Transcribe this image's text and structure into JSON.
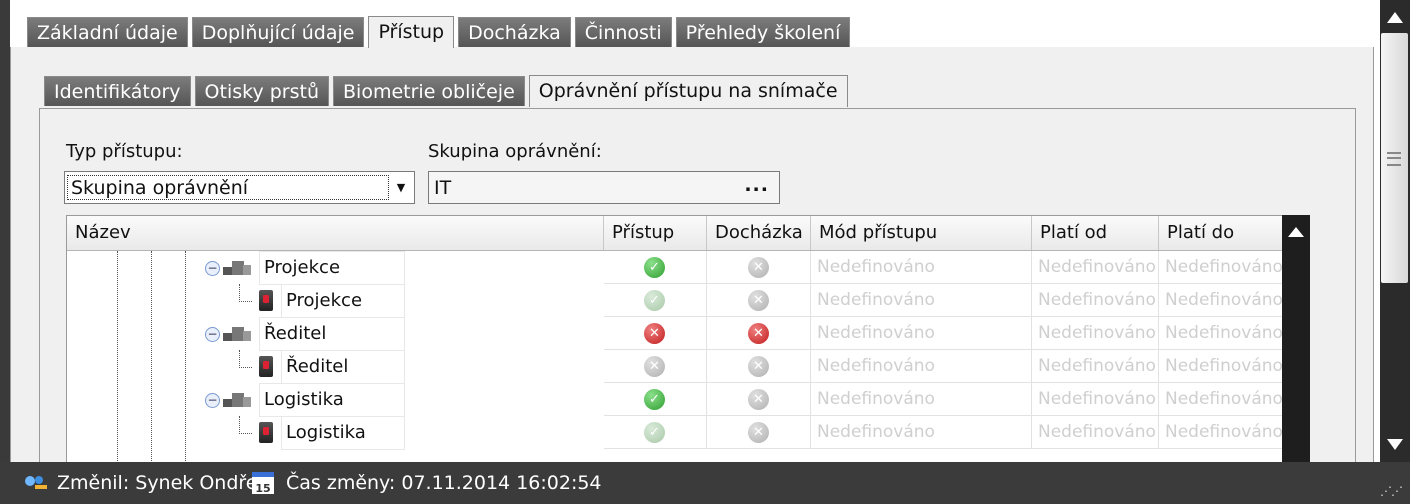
{
  "tabs": [
    "Základní údaje",
    "Doplňující údaje",
    "Přístup",
    "Docházka",
    "Činnosti",
    "Přehledy školení"
  ],
  "active_tab": "Přístup",
  "subtabs": [
    "Identifikátory",
    "Otisky prstů",
    "Biometrie obličeje",
    "Oprávnění přístupu na snímače"
  ],
  "active_subtab": "Oprávnění přístupu na snímače",
  "form": {
    "type_label": "Typ přístupu:",
    "type_value": "Skupina oprávnění",
    "group_label": "Skupina oprávnění:",
    "group_value": "IT",
    "group_button": "..."
  },
  "grid": {
    "columns": [
      "Název",
      "Přístup",
      "Docházka",
      "Mód přístupu",
      "Platí od",
      "Platí do"
    ],
    "rows": [
      {
        "kind": "group",
        "name": "Projekce",
        "access": "ok",
        "attendance": "no-dim",
        "mode": "Nedefinováno",
        "from": "Nedefinováno",
        "to": "Nedefinováno"
      },
      {
        "kind": "device",
        "name": "Projekce",
        "access": "ok-dim",
        "attendance": "no-dim",
        "mode": "Nedefinováno",
        "from": "Nedefinováno",
        "to": "Nedefinováno"
      },
      {
        "kind": "group",
        "name": "Ředitel",
        "access": "no",
        "attendance": "no",
        "mode": "Nedefinováno",
        "from": "Nedefinováno",
        "to": "Nedefinováno"
      },
      {
        "kind": "device",
        "name": "Ředitel",
        "access": "no-dim",
        "attendance": "no-dim",
        "mode": "Nedefinováno",
        "from": "Nedefinováno",
        "to": "Nedefinováno"
      },
      {
        "kind": "group",
        "name": "Logistika",
        "access": "ok",
        "attendance": "no-dim",
        "mode": "Nedefinováno",
        "from": "Nedefinováno",
        "to": "Nedefinováno"
      },
      {
        "kind": "device",
        "name": "Logistika",
        "access": "ok-dim",
        "attendance": "no-dim",
        "mode": "Nedefinováno",
        "from": "Nedefinováno",
        "to": "Nedefinováno"
      }
    ]
  },
  "status": {
    "changed_by": "Změnil: Synek Ondřej",
    "changed_at": "Čas změny: 07.11.2014 16:02:54",
    "calendar_icon_text": "15"
  },
  "colors": {
    "ok": "#2f9e2f",
    "no": "#c21d1d",
    "status_bar": "#3b3b3b"
  }
}
